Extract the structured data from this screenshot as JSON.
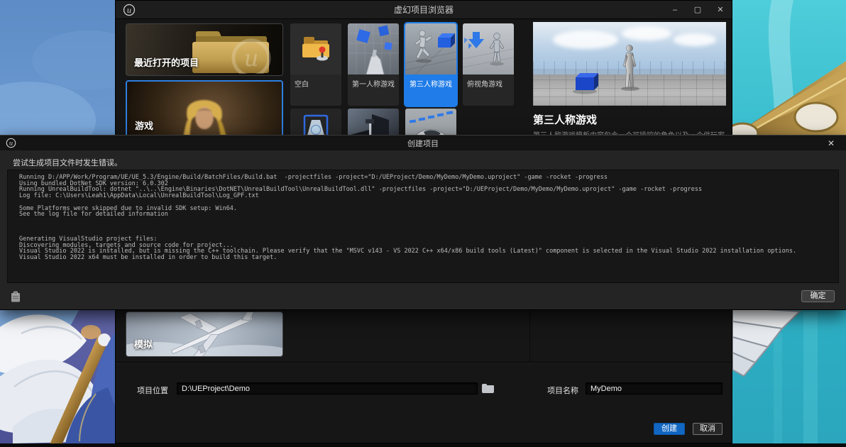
{
  "window": {
    "title": "虚幻项目浏览器",
    "controls": {
      "minimize": "–",
      "maximize": "▢",
      "close": "✕"
    }
  },
  "nav": {
    "recent_label": "最近打开的项目",
    "games_label": "游戏",
    "sim_label": "模拟"
  },
  "templates": [
    {
      "label": "空白"
    },
    {
      "label": "第一人称游戏"
    },
    {
      "label": "第三人称游戏"
    },
    {
      "label": "俯视角游戏"
    }
  ],
  "detail": {
    "title": "第三人称游戏",
    "description": "第三人称游戏模板内容包含一个可操控的角色以及一个供玩家使用的角色。"
  },
  "form": {
    "location_label": "项目位置",
    "location_value": "D:\\UEProject\\Demo",
    "name_label": "项目名称",
    "name_value": "MyDemo"
  },
  "actions": {
    "create": "创建",
    "cancel": "取消"
  },
  "dialog": {
    "title": "创建项目",
    "close": "✕",
    "error": "尝试生成项目文件时发生错误。",
    "ok": "确定",
    "log": "Running D:/APP/Work/Program/UE/UE_5.3/Engine/Build/BatchFiles/Build.bat  -projectfiles -project=\"D:/UEProject/Demo/MyDemo/MyDemo.uproject\" -game -rocket -progress\nUsing bundled DotNet SDK version: 6.0.302\nRunning UnrealBuildTool: dotnet \"..\\..\\Engine\\Binaries\\DotNET\\UnrealBuildTool\\UnrealBuildTool.dll\" -projectfiles -project=\"D:/UEProject/Demo/MyDemo/MyDemo.uproject\" -game -rocket -progress\nLog file: C:\\Users\\Leah1\\AppData\\Local\\UnrealBuildTool\\Log_GPF.txt\n\nSome Platforms were skipped due to invalid SDK setup: Win64.\nSee the log file for detailed information\n\n\n\nGenerating VisualStudio project files:\nDiscovering modules, targets and source code for project...\nVisual Studio 2022 is installed, but is missing the C++ toolchain. Please verify that the \"MSVC v143 - VS 2022 C++ x64/x86 build tools (Latest)\" component is selected in the Visual Studio 2022 installation options.\nVisual Studio 2022 x64 must be installed in order to build this target."
  },
  "colors": {
    "accent": "#0070e0",
    "tile_selected": "#1f7ce8",
    "create_button": "#1167c2"
  }
}
